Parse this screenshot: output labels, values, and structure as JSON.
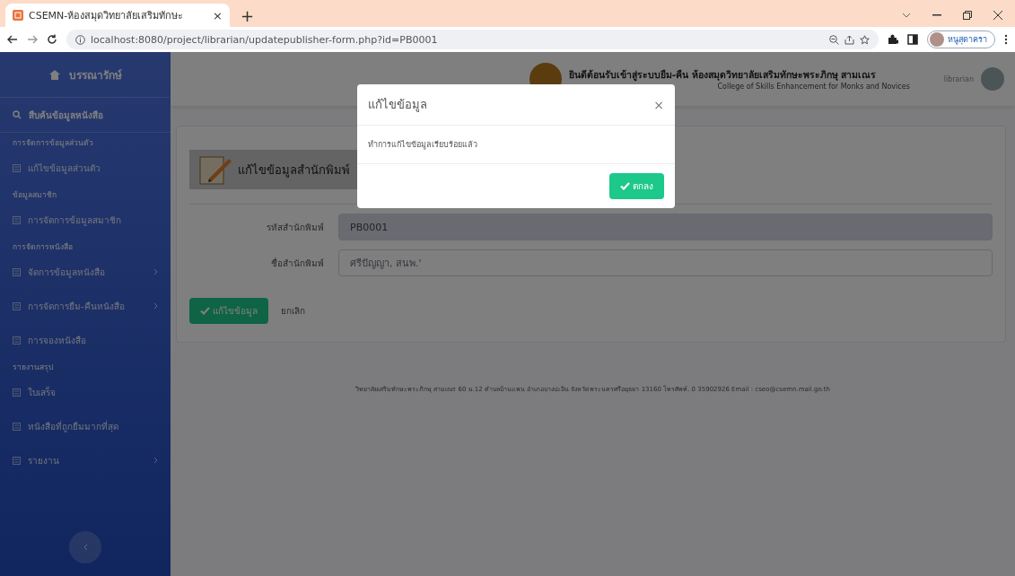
{
  "browser": {
    "tab_title": "CSEMN-ห้องสมุดวิทยาลัยเสริมทักษะ",
    "tab_close": "×",
    "new_tab": "+",
    "url": "localhost:8080/project/librarian/updatepublisher-form.php?id=PB0001",
    "profile_name": "หนูสุดาครา"
  },
  "sidebar": {
    "brand": "บรรณารักษ์",
    "items": [
      {
        "kind": "search",
        "label": "สืบค้นข้อมูลหนังสือ",
        "selected": true
      },
      {
        "kind": "heading",
        "label": "การจัดการข้อมูลส่วนตัว"
      },
      {
        "kind": "link",
        "label": "แก้ไขข้อมูลส่วนตัว",
        "selected": false
      },
      {
        "kind": "heading",
        "label": "ข้อมูลสมาชิก"
      },
      {
        "kind": "link",
        "label": "การจัดการข้อมูลสมาชิก",
        "selected": false
      },
      {
        "kind": "heading",
        "label": "การจัดการหนังสือ"
      },
      {
        "kind": "submenu",
        "label": "จัดการข้อมูลหนังสือ",
        "selected": false
      },
      {
        "kind": "submenu",
        "label": "การจัดการยืม-คืนหนังสือ",
        "selected": false
      },
      {
        "kind": "link",
        "label": "การจองหนังสือ",
        "selected": false
      },
      {
        "kind": "heading",
        "label": "รายงานสรุป"
      },
      {
        "kind": "link",
        "label": "ใบเสร็จ",
        "selected": false
      },
      {
        "kind": "link",
        "label": "หนังสือที่ถูกยืมมากที่สุด",
        "selected": false
      },
      {
        "kind": "submenu",
        "label": "รายงาน",
        "selected": false
      }
    ]
  },
  "header": {
    "title": "ยินดีต้อนรับเข้าสู่ระบบยืม-คืน ห้องสมุดวิทยาลัยเสริมทักษะพระภิกษุ สามเณร",
    "subtitle": "College of Skills Enhancement for Monks and Novices",
    "user": "librarian"
  },
  "form": {
    "heading": "แก้ไขข้อมูลสำนักพิมพ์",
    "fields": [
      {
        "label": "รหัสสำนักพิมพ์",
        "value": "PB0001",
        "readonly": true
      },
      {
        "label": "ชื่อสำนักพิมพ์",
        "value": "ศรีปัญญา, สนพ.'",
        "readonly": false
      }
    ],
    "submit": "แก้ไขข้อมูล",
    "cancel": "ยกเลิก"
  },
  "footer": {
    "text": "วิทยาลัยเสริมทักษะพระภิกษุ สามเณร 60 ม.12 ตำบลบ้านแพน อำเภอบางปะอิน จังหวัดพระนครศรีอยุธยา 13160 โทรศัพท์. 0 35902926 Email : cseo@csemn.mail.go.th"
  },
  "modal": {
    "title": "แก้ไขข้อมูล",
    "close": "×",
    "message": "ทำการแก้ไขข้อมูลเรียบร้อยแล้ว",
    "ok": "ตกลง"
  }
}
